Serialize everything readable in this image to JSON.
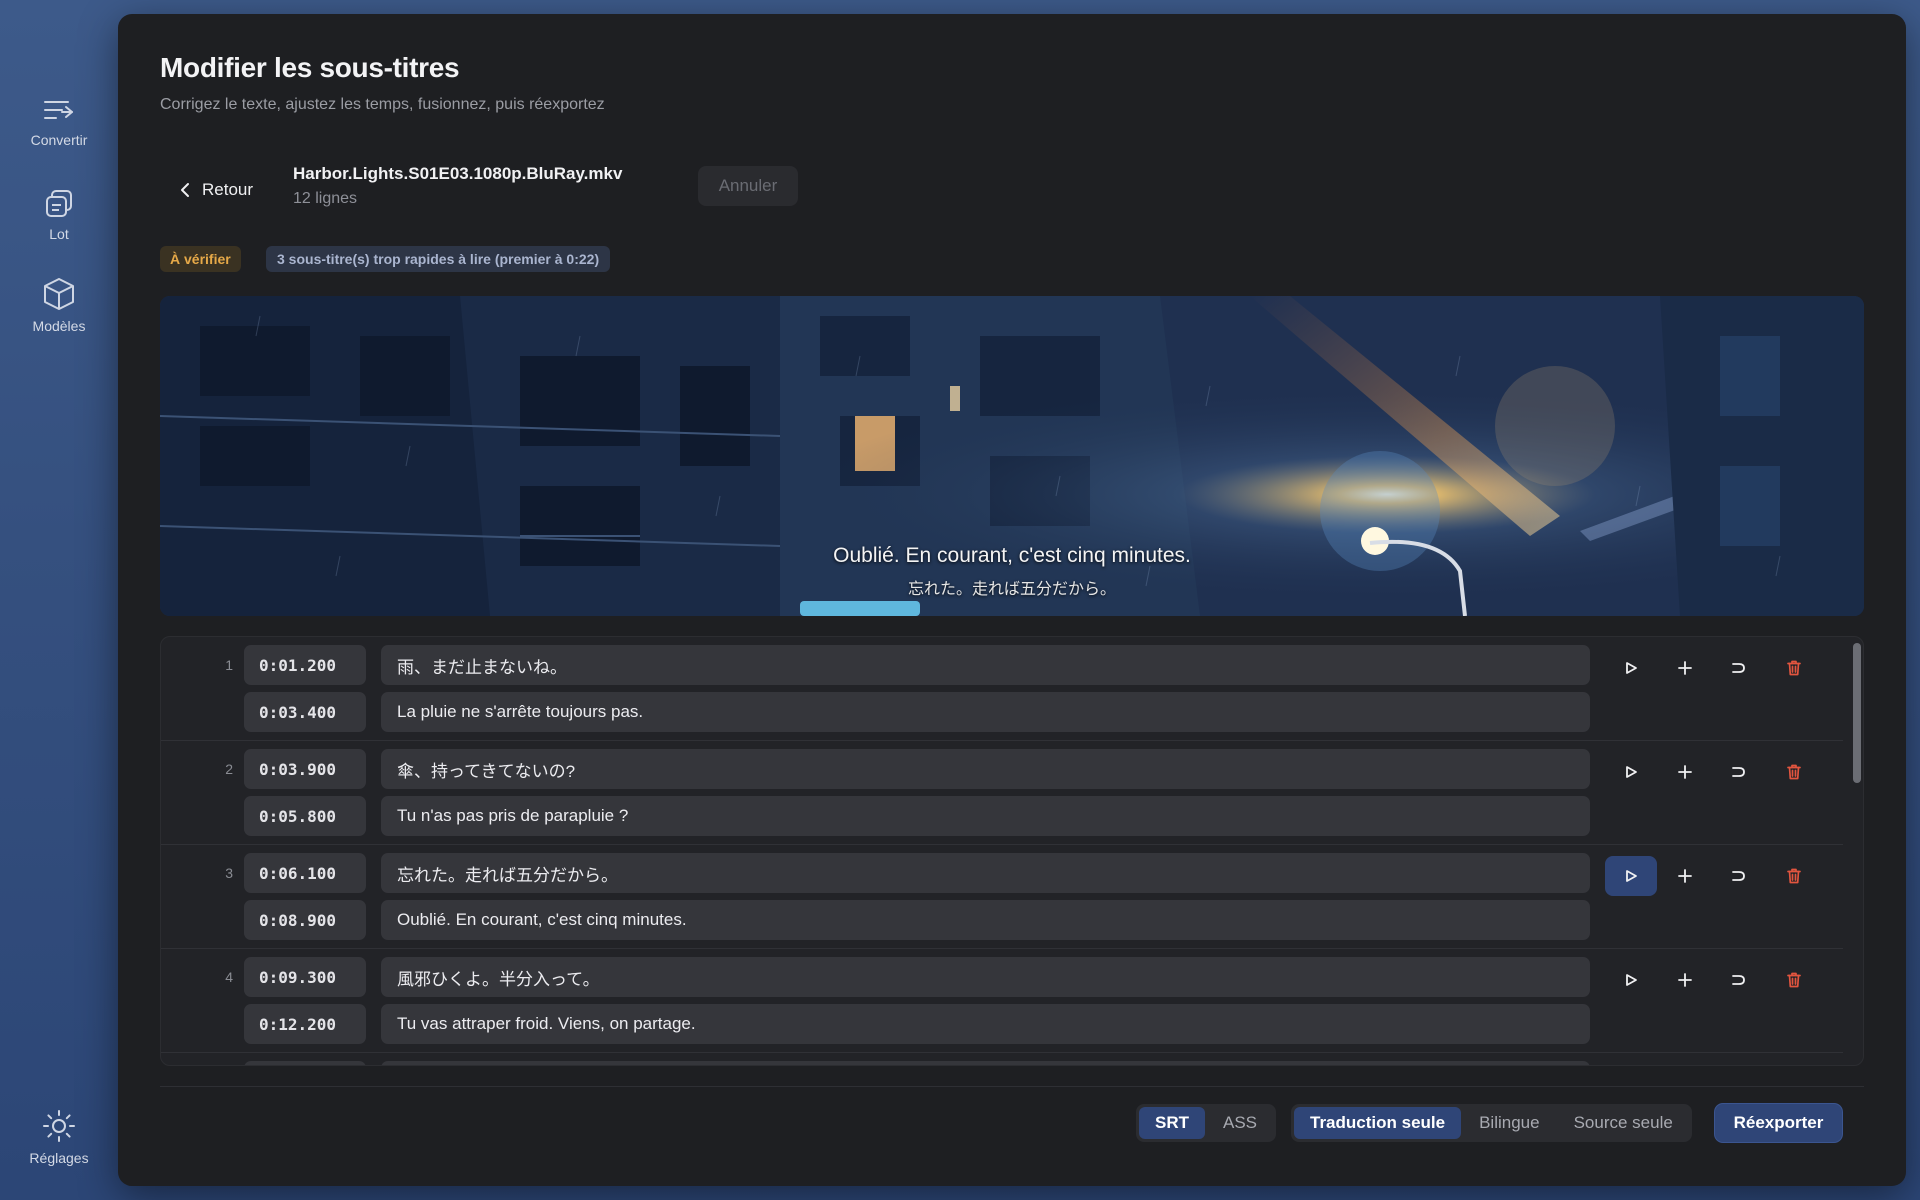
{
  "sidebar": {
    "items": [
      {
        "label": "Convertir",
        "icon": "convert-icon"
      },
      {
        "label": "Lot",
        "icon": "batch-icon"
      },
      {
        "label": "Modèles",
        "icon": "cube-icon"
      }
    ],
    "settings": {
      "label": "Réglages",
      "icon": "sun-gear-icon"
    }
  },
  "header": {
    "title": "Modifier les sous-titres",
    "subtitle": "Corrigez le texte, ajustez les temps, fusionnez, puis réexportez"
  },
  "toolbar": {
    "back_label": "Retour",
    "file_name": "Harbor.Lights.S01E03.1080p.BluRay.mkv",
    "line_count": "12 lignes",
    "cancel_label": "Annuler"
  },
  "badges": {
    "status": "À vérifier",
    "warning": "3 sous-titre(s) trop rapides à lire (premier à 0:22)"
  },
  "preview": {
    "subtitle_translation": "Oublié. En courant, c'est cinq minutes.",
    "subtitle_source": "忘れた。走れば五分だから。"
  },
  "rows": [
    {
      "num": "1",
      "start": "0:01.200",
      "end": "0:03.400",
      "source": "雨、まだ止まないね。",
      "translation": "La pluie ne s'arrête toujours pas."
    },
    {
      "num": "2",
      "start": "0:03.900",
      "end": "0:05.800",
      "source": "傘、持ってきてないの?",
      "translation": "Tu n'as pas pris de parapluie ?"
    },
    {
      "num": "3",
      "start": "0:06.100",
      "end": "0:08.900",
      "source": "忘れた。走れば五分だから。",
      "translation": "Oublié. En courant, c'est cinq minutes."
    },
    {
      "num": "4",
      "start": "0:09.300",
      "end": "0:12.200",
      "source": "風邪ひくよ。半分入って。",
      "translation": "Tu vas attraper froid. Viens, on partage."
    }
  ],
  "footer": {
    "format_options": [
      "SRT",
      "ASS"
    ],
    "format_selected": "SRT",
    "mode_options": [
      "Traduction seule",
      "Bilingue",
      "Source seule"
    ],
    "mode_selected": "Traduction seule",
    "export_label": "Réexporter"
  },
  "colors": {
    "accent": "#2f4577",
    "warning": "#e6a948",
    "danger": "#e2553f",
    "panel": "#1e1f22"
  }
}
